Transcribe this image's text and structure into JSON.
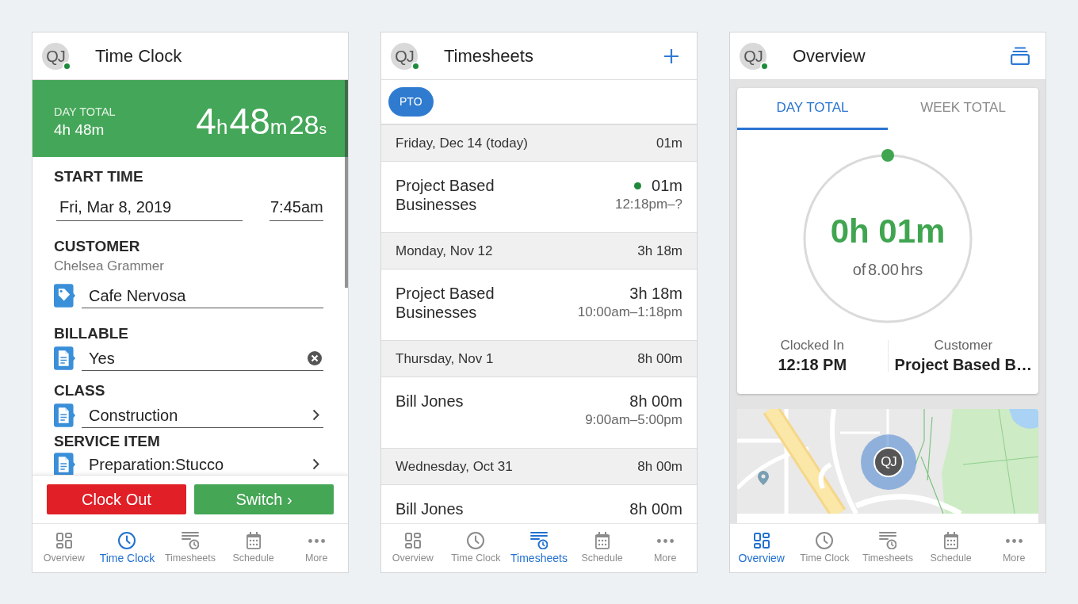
{
  "screens": [
    {
      "kind": "time_clock",
      "header": {
        "avatar": "QJ",
        "online": true,
        "title": "Time Clock"
      },
      "banner": {
        "label": "DAY TOTAL",
        "total": "4h 48m",
        "timer": [
          {
            "value": "4",
            "unit": "h"
          },
          {
            "value": "48",
            "unit": "m"
          },
          {
            "value": "28",
            "unit": "s"
          }
        ]
      },
      "start_time": {
        "label": "START TIME",
        "date": "Fri, Mar 8, 2019",
        "time": "7:45am"
      },
      "fields": [
        {
          "kind": "tagged",
          "label": "CUSTOMER",
          "note": "Chelsea Grammer",
          "value": "Cafe Nervosa"
        },
        {
          "kind": "clearable",
          "label": "BILLABLE",
          "value": "Yes"
        },
        {
          "kind": "picker",
          "label": "CLASS",
          "value": "Construction"
        },
        {
          "kind": "picker",
          "label": "SERVICE ITEM",
          "value": "Preparation:Stucco"
        }
      ],
      "buttons": [
        {
          "label": "Clock Out",
          "kind": "clock_out"
        },
        {
          "label": "Switch ›",
          "kind": "switch"
        }
      ],
      "nav": [
        {
          "label": "Overview",
          "selected": false
        },
        {
          "label": "Time Clock",
          "selected": true
        },
        {
          "label": "Timesheets",
          "selected": false
        },
        {
          "label": "Schedule",
          "selected": false
        },
        {
          "label": "More",
          "selected": false
        }
      ]
    },
    {
      "kind": "timesheets",
      "header": {
        "avatar": "QJ",
        "online": true,
        "title": "Timesheets"
      },
      "filter_button": "PTO",
      "days": [
        {
          "date": "Friday, Dec 14 (today)",
          "total": "01m",
          "entries": [
            {
              "name": "Project Based Businesses",
              "duration": "01m",
              "range": "12:18pm–?",
              "running": true
            }
          ]
        },
        {
          "date": "Monday, Nov 12",
          "total": "3h 18m",
          "entries": [
            {
              "name": "Project Based Businesses",
              "duration": "3h 18m",
              "range": "10:00am–1:18pm",
              "running": false
            }
          ]
        },
        {
          "date": "Thursday, Nov 1",
          "total": "8h 00m",
          "entries": [
            {
              "name": "Bill Jones",
              "duration": "8h 00m",
              "range": "9:00am–5:00pm",
              "running": false
            }
          ]
        },
        {
          "date": "Wednesday, Oct 31",
          "total": "8h 00m",
          "entries": [
            {
              "name": "Bill Jones",
              "duration": "8h 00m",
              "running": false
            }
          ]
        }
      ],
      "nav": [
        {
          "label": "Overview",
          "selected": false
        },
        {
          "label": "Time Clock",
          "selected": false
        },
        {
          "label": "Timesheets",
          "selected": true
        },
        {
          "label": "Schedule",
          "selected": false
        },
        {
          "label": "More",
          "selected": false
        }
      ]
    },
    {
      "kind": "overview",
      "header": {
        "avatar": "QJ",
        "online": true,
        "title": "Overview"
      },
      "tabs": [
        {
          "label": "DAY TOTAL",
          "selected": true
        },
        {
          "label": "WEEK TOTAL",
          "selected": false
        }
      ],
      "ring": {
        "value": "0h 01m",
        "caption": "of 8.00 hrs"
      },
      "stats": [
        {
          "label": "Clocked In",
          "value": "12:18 PM"
        },
        {
          "label": "Customer",
          "value": "Project Based B…"
        }
      ],
      "map": {
        "marker": "QJ"
      },
      "nav": [
        {
          "label": "Overview",
          "selected": true
        },
        {
          "label": "Time Clock",
          "selected": false
        },
        {
          "label": "Timesheets",
          "selected": false
        },
        {
          "label": "Schedule",
          "selected": false
        },
        {
          "label": "More",
          "selected": false
        }
      ]
    }
  ]
}
